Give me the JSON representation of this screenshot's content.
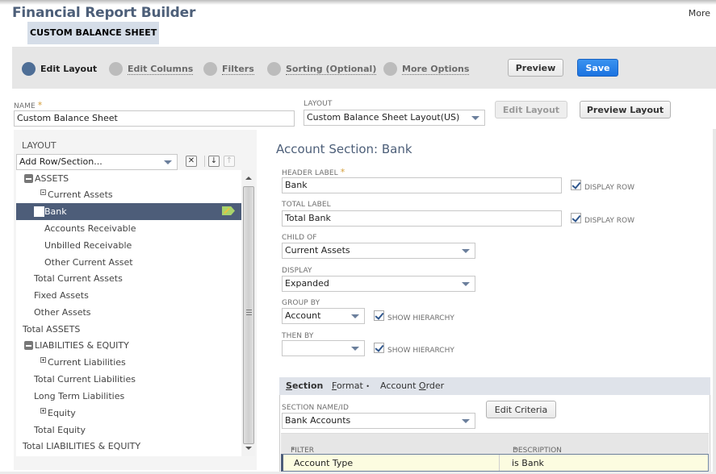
{
  "header": {
    "app_title": "Financial Report Builder",
    "subtitle": "CUSTOM BALANCE SHEET",
    "more_link": "More"
  },
  "wizard": {
    "steps": [
      {
        "label": "Edit Layout",
        "active": true
      },
      {
        "label": "Edit Columns",
        "active": false
      },
      {
        "label": "Filters",
        "active": false
      },
      {
        "label": "Sorting (Optional)",
        "active": false
      },
      {
        "label": "More Options",
        "active": false
      }
    ],
    "preview_label": "Preview",
    "save_label": "Save"
  },
  "form": {
    "name_label": "NAME",
    "name_required": "*",
    "name_value": "Custom Balance Sheet",
    "layout_label": "LAYOUT",
    "layout_value": "Custom Balance Sheet Layout(US)",
    "edit_layout_label": "Edit Layout",
    "preview_layout_label": "Preview Layout"
  },
  "tree_panel": {
    "label": "LAYOUT",
    "add_select_value": "Add Row/Section...",
    "remove_icon": "close-x",
    "move_down_icon": "arrow-down",
    "move_up_icon": "arrow-up",
    "rows": [
      {
        "label": "ASSETS",
        "toggle": "collapse-big"
      },
      {
        "label": "Current Assets",
        "toggle": "collapse-small"
      },
      {
        "label": "Bank",
        "selected": true
      },
      {
        "label": "Accounts Receivable"
      },
      {
        "label": "Unbilled Receivable"
      },
      {
        "label": "Other Current Asset"
      },
      {
        "label": "Total Current Assets"
      },
      {
        "label": "Fixed Assets"
      },
      {
        "label": "Other Assets"
      },
      {
        "label": "Total ASSETS"
      },
      {
        "label": "LIABILITIES & EQUITY",
        "toggle": "collapse-big"
      },
      {
        "label": "Current Liabilities",
        "toggle": "expand-small"
      },
      {
        "label": "Total Current Liabilities"
      },
      {
        "label": "Long Term Liabilities"
      },
      {
        "label": "Equity",
        "toggle": "expand-small"
      },
      {
        "label": "Total Equity"
      },
      {
        "label": "Total LIABILITIES & EQUITY"
      }
    ]
  },
  "section": {
    "title": "Account Section: Bank",
    "header_label_label": "HEADER LABEL",
    "header_label_required": "*",
    "header_label_value": "Bank",
    "header_display_row": "DISPLAY ROW",
    "header_display_row_checked": true,
    "total_label_label": "TOTAL LABEL",
    "total_label_value": "Total Bank",
    "total_display_row": "DISPLAY ROW",
    "total_display_row_checked": true,
    "child_of_label": "CHILD OF",
    "child_of_value": "Current Assets",
    "display_label": "DISPLAY",
    "display_value": "Expanded",
    "group_by_label": "GROUP BY",
    "group_by_value": "Account",
    "group_by_show_hierarchy": "SHOW HIERARCHY",
    "group_by_show_hierarchy_checked": true,
    "then_by_label": "THEN BY",
    "then_by_value": "",
    "then_by_show_hierarchy": "SHOW HIERARCHY",
    "then_by_show_hierarchy_checked": true
  },
  "subtabs": {
    "tabs": [
      {
        "label_pre": "",
        "label_key": "S",
        "label_post": "ection",
        "active": true
      },
      {
        "label_pre": "",
        "label_key": "F",
        "label_post": "ormat",
        "suffix": "•",
        "active": false
      },
      {
        "label_pre": "Account ",
        "label_key": "O",
        "label_post": "rder",
        "active": false
      }
    ],
    "section_name_label": "SECTION NAME/ID",
    "section_name_value": "Bank Accounts",
    "edit_criteria_label": "Edit Criteria",
    "filter_header": "FILTER",
    "description_header": "DESCRIPTION",
    "required_mark": "*",
    "filter_rows": [
      {
        "filter": "Account Type",
        "description": "is Bank"
      }
    ]
  }
}
